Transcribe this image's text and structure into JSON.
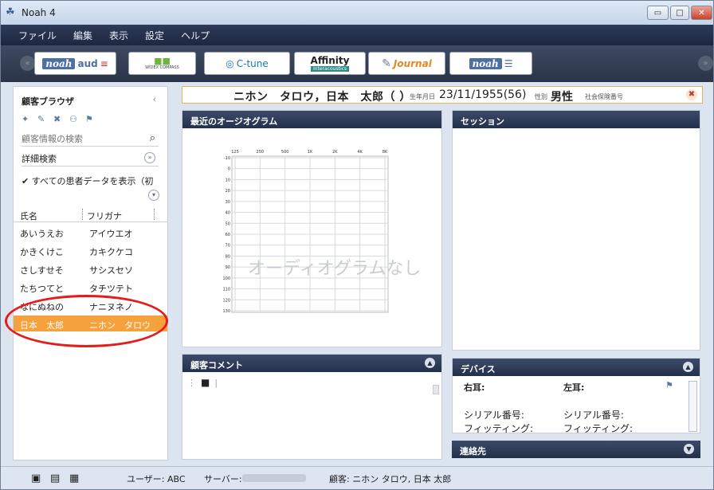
{
  "window": {
    "title": "Noah 4",
    "minimize": "▭",
    "maximize": "□",
    "close": "✕"
  },
  "menu": [
    "ファイル",
    "編集",
    "表示",
    "設定",
    "ヘルプ"
  ],
  "modules": {
    "noahaud_a": "noah",
    "noahaud_b": "aud",
    "widex": "WIDEX COMPASS",
    "ctune": "C-tune",
    "affinity": "Affinity",
    "affinity_sub": "Interacoustics",
    "journal": "Journal",
    "noah2": "noah"
  },
  "sidebar": {
    "title": "顧客ブラウザ",
    "search_placeholder": "顧客情報の検索",
    "advanced": "詳細検索",
    "show_all": "すべての患者データを表示（初",
    "col_name": "氏名",
    "col_kana": "フリガナ",
    "rows": [
      {
        "name": "あいうえお",
        "kana": "アイウエオ"
      },
      {
        "name": "かきくけこ",
        "kana": "カキクケコ"
      },
      {
        "name": "さしすせそ",
        "kana": "サシスセソ"
      },
      {
        "name": "たちつてと",
        "kana": "タチツテト"
      },
      {
        "name": "なにぬねの",
        "kana": "ナニヌネノ"
      },
      {
        "name": "日本　太郎",
        "kana": "ニホン　タロウ"
      }
    ]
  },
  "patient": {
    "name": "ニホン　タロウ，日本　太郎（ ）",
    "dob_label": "生年月日",
    "dob": "23/11/1955(56)",
    "sex_label": "性別",
    "sex": "男性",
    "insurance_label": "社会保険番号"
  },
  "audiogram": {
    "title": "最近のオージオグラム",
    "freqs": [
      "125",
      "250",
      "500",
      "1K",
      "2K",
      "4K",
      "8K"
    ],
    "levels": [
      "-10",
      "0",
      "10",
      "20",
      "30",
      "40",
      "50",
      "60",
      "70",
      "80",
      "90",
      "100",
      "110",
      "120",
      "130"
    ],
    "empty": "オーディオグラムなし"
  },
  "session": {
    "title": "セッション"
  },
  "comment": {
    "title": "顧客コメント"
  },
  "devices": {
    "title": "デバイス",
    "right": "右耳:",
    "left": "左耳:",
    "serial_r": "シリアル番号:",
    "serial_l": "シリアル番号:",
    "fit_r": "フィッティング:",
    "fit_l": "フィッティング:"
  },
  "contacts": {
    "title": "連絡先"
  },
  "status": {
    "user": "ユーザー: ABC",
    "server": "サーバー:",
    "client": "顧客: ニホン タロウ, 日本 太郎"
  },
  "colors": {
    "accent": "#f6a23c",
    "navy": "#23304b",
    "annotation": "#e51c1c"
  }
}
